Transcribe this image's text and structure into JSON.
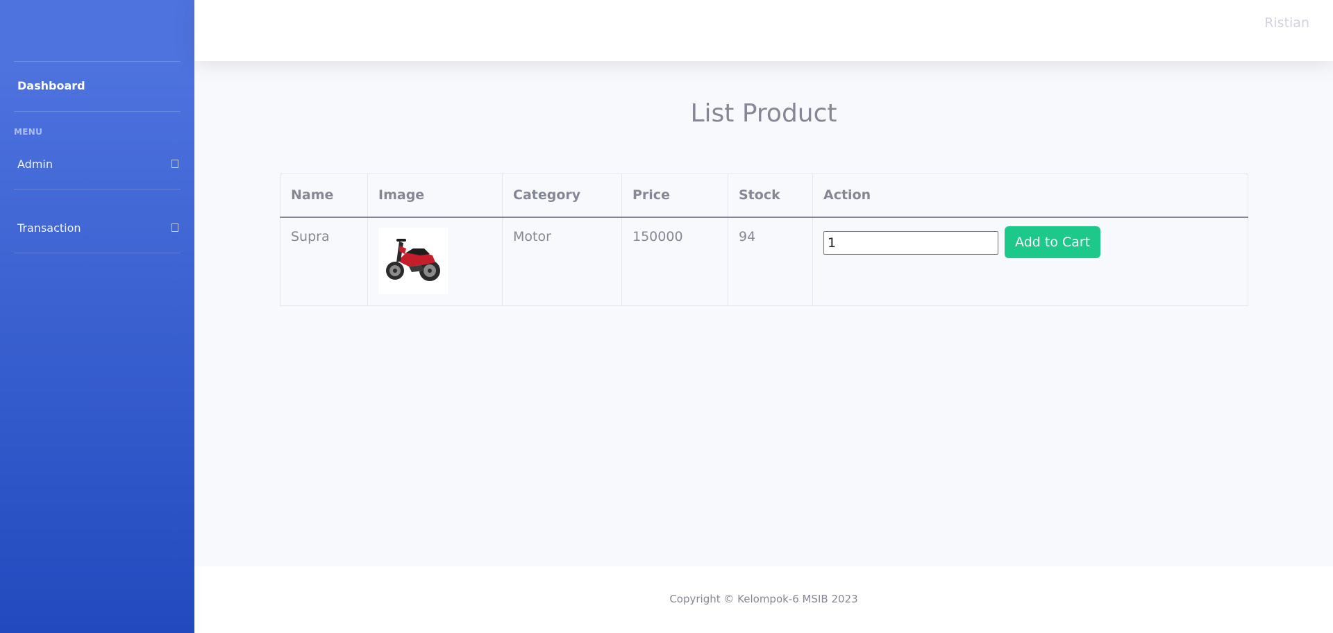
{
  "sidebar": {
    "dashboard_label": "Dashboard",
    "menu_heading": "MENU",
    "items": [
      {
        "label": "Admin"
      },
      {
        "label": "Transaction"
      }
    ]
  },
  "topbar": {
    "user_name": "Ristian"
  },
  "main": {
    "title": "List Product",
    "table": {
      "headers": [
        "Name",
        "Image",
        "Category",
        "Price",
        "Stock",
        "Action"
      ],
      "rows": [
        {
          "name": "Supra",
          "image_alt": "motorcycle-image",
          "category": "Motor",
          "price": "150000",
          "stock": "94",
          "qty_value": "1",
          "button_label": "Add to Cart"
        }
      ]
    }
  },
  "footer": {
    "copyright": "Copyright © Kelompok-6 MSIB 2023"
  },
  "colors": {
    "sidebar_top": "#4e73df",
    "sidebar_bottom": "#224abe",
    "success": "#1cc88a",
    "text_muted": "#858796",
    "background": "#f8f9fc"
  }
}
